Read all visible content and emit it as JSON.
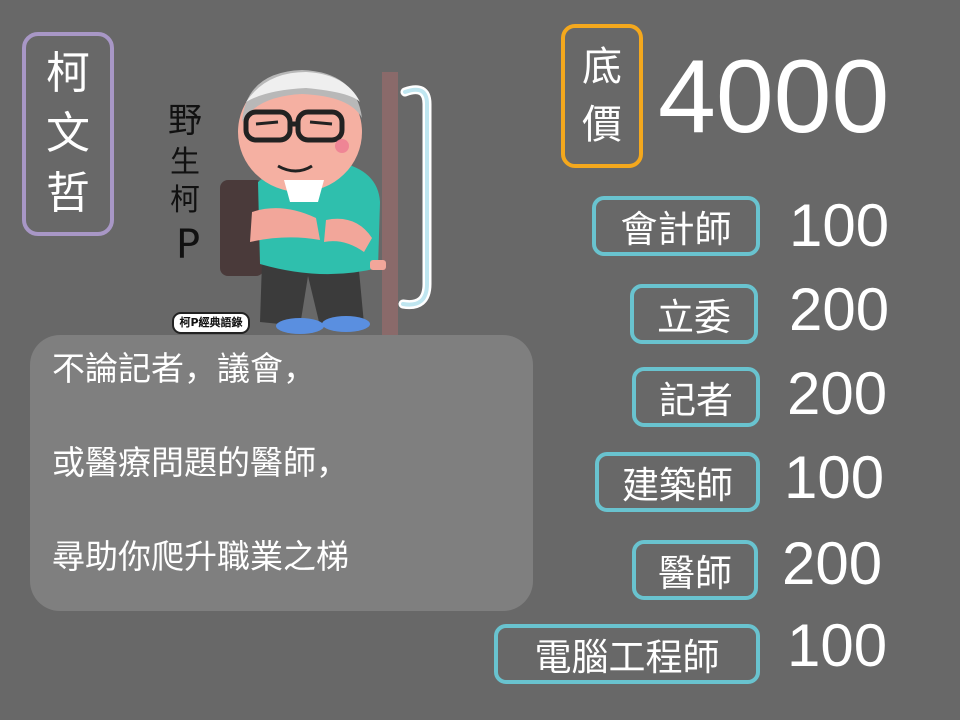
{
  "name": {
    "chars": [
      "柯",
      "文",
      "哲"
    ]
  },
  "sticker": {
    "side_text": [
      "野",
      "生",
      "柯",
      "P"
    ],
    "tag": "柯P經典語錄"
  },
  "speech": {
    "lines": [
      "不論記者，議會，",
      "或醫療問題的醫師，",
      "尋助你爬升職業之梯"
    ]
  },
  "base_price": {
    "label_chars": [
      "底",
      "價"
    ],
    "value": "4000"
  },
  "jobs": [
    {
      "label": "會計師",
      "value": "100"
    },
    {
      "label": "立委",
      "value": "200"
    },
    {
      "label": "記者",
      "value": "200"
    },
    {
      "label": "建築師",
      "value": "100"
    },
    {
      "label": "醫師",
      "value": "200"
    },
    {
      "label": "電腦工程師",
      "value": "100"
    }
  ],
  "colors": {
    "background": "#686868",
    "name_border": "#a897c6",
    "base_border": "#f4a81d",
    "job_border": "#69c3cf",
    "speech_fill": "#7f7f7f"
  }
}
